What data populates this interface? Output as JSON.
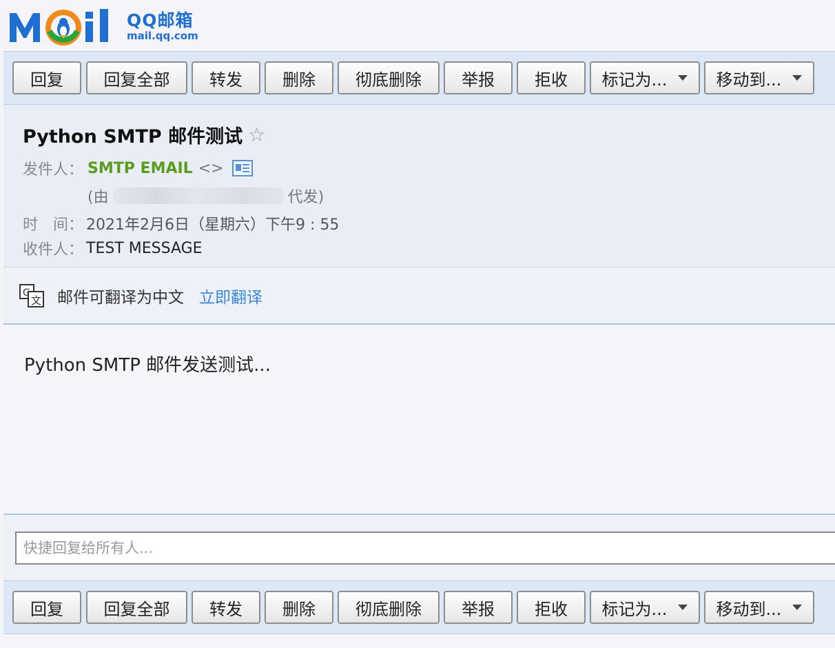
{
  "logo": {
    "brand": "QQ邮箱",
    "domain": "mail.qq.com",
    "colors": {
      "blue": "#1e6fd0",
      "orange": "#f08a1c",
      "green": "#2aa43a"
    }
  },
  "toolbar": {
    "buttons": [
      {
        "label": "回复",
        "dropdown": false
      },
      {
        "label": "回复全部",
        "dropdown": false
      },
      {
        "label": "转发",
        "dropdown": false
      },
      {
        "label": "删除",
        "dropdown": false
      },
      {
        "label": "彻底删除",
        "dropdown": false
      },
      {
        "label": "举报",
        "dropdown": false
      },
      {
        "label": "拒收",
        "dropdown": false
      },
      {
        "label": "标记为...",
        "dropdown": true
      },
      {
        "label": "移动到...",
        "dropdown": true
      }
    ]
  },
  "message": {
    "subject": "Python SMTP 邮件测试",
    "star_icon": "☆",
    "sender_label": "发件人：",
    "sender_name": "SMTP EMAIL",
    "sender_address": "<>",
    "via_prefix": "(由",
    "via_suffix": "代发)",
    "time_label": "时　间：",
    "time_value": "2021年2月6日（星期六）下午9 : 55",
    "recipient_label": "收件人：",
    "recipient_value": "TEST MESSAGE",
    "sender_color": "#5a9c1c"
  },
  "translate": {
    "text": "邮件可翻译为中文",
    "link": "立即翻译",
    "link_color": "#3a86d8"
  },
  "body": {
    "text": "Python SMTP 邮件发送测试..."
  },
  "quick_reply": {
    "placeholder": "快捷回复给所有人..."
  }
}
